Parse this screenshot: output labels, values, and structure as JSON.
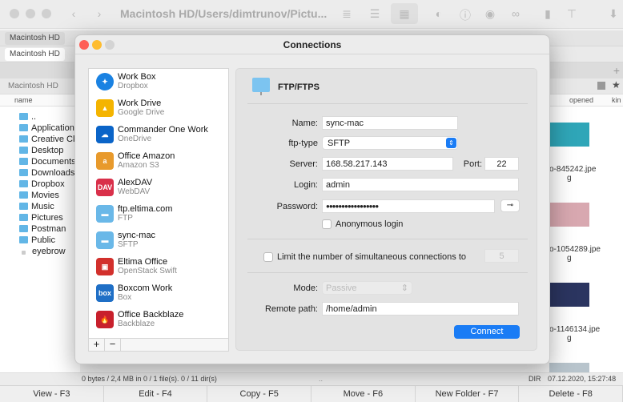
{
  "window": {
    "path_title": "Macintosh HD/Users/dimtrunov/Pictu..."
  },
  "tabs": {
    "top_left": "Macintosh HD",
    "second_left": "Macintosh HD",
    "path_left": "Macintosh HD"
  },
  "columns": {
    "left_name": "name",
    "right_opened": "opened",
    "right_kind": "kin"
  },
  "left_files": [
    "..",
    "Application",
    "Creative Cl",
    "Desktop",
    "Documents",
    "Downloads",
    "Dropbox",
    "Movies",
    "Music",
    "Pictures",
    "Postman",
    "Public",
    "eyebrow"
  ],
  "right_files": [
    {
      "name": "o-845242.jpe",
      "wrap": "g",
      "color": "#2fa6b8"
    },
    {
      "name": "o-1054289.jpe",
      "wrap": "g",
      "color": "#d8a8b0"
    },
    {
      "name": "o-1146134.jpe",
      "wrap": "g",
      "color": "#2b3560"
    }
  ],
  "status": {
    "left": "0 bytes / 2,4 MB in 0 / 1 file(s). 0 / 11 dir(s)",
    "middle": "..",
    "kind": "DIR",
    "date": "07.12.2020, 15:27:48"
  },
  "fkeys": [
    "View - F3",
    "Edit - F4",
    "Copy - F5",
    "Move - F6",
    "New Folder - F7",
    "Delete - F8"
  ],
  "dialog": {
    "title": "Connections",
    "connections": [
      {
        "name": "Work Box",
        "type": "Dropbox",
        "icon": "dropbox-icon",
        "color": "#1a82e2",
        "glyph": "✦"
      },
      {
        "name": "Work Drive",
        "type": "Google Drive",
        "icon": "google-drive-icon",
        "color": "#f4b400",
        "glyph": "▲"
      },
      {
        "name": "Commander One Work",
        "type": "OneDrive",
        "icon": "onedrive-icon",
        "color": "#0a64c8",
        "glyph": "☁"
      },
      {
        "name": "Office Amazon",
        "type": "Amazon S3",
        "icon": "amazon-s3-icon",
        "color": "#e89a2c",
        "glyph": "a"
      },
      {
        "name": "AlexDAV",
        "type": "WebDAV",
        "icon": "webdav-icon",
        "color": "#d9304a",
        "glyph": "DAV"
      },
      {
        "name": "ftp.eltima.com",
        "type": "FTP",
        "icon": "ftp-icon",
        "color": "#6ab8e8",
        "glyph": "▬"
      },
      {
        "name": "sync-mac",
        "type": "SFTP",
        "icon": "sftp-icon",
        "color": "#6ab8e8",
        "glyph": "▬"
      },
      {
        "name": "Eltima Office",
        "type": "OpenStack Swift",
        "icon": "openstack-icon",
        "color": "#d2302c",
        "glyph": "▣"
      },
      {
        "name": "Boxcom Work",
        "type": "Box",
        "icon": "box-icon",
        "color": "#1f6fc6",
        "glyph": "box"
      },
      {
        "name": "Office Backblaze",
        "type": "Backblaze",
        "icon": "backblaze-icon",
        "color": "#c8202c",
        "glyph": "🔥"
      }
    ],
    "add_label": "+",
    "remove_label": "−",
    "protocol": "FTP/FTPS",
    "form": {
      "name_label": "Name:",
      "name_value": "sync-mac",
      "ftptype_label": "ftp-type",
      "ftptype_value": "SFTP",
      "server_label": "Server:",
      "server_value": "168.58.217.143",
      "port_label": "Port:",
      "port_value": "22",
      "login_label": "Login:",
      "login_value": "admin",
      "password_label": "Password:",
      "password_value": "●●●●●●●●●●●●●●●●●",
      "anonymous_label": "Anonymous login",
      "anonymous_checked": false,
      "limit_label": "Limit the number of simultaneous connections to",
      "limit_value": "5",
      "limit_checked": false,
      "mode_label": "Mode:",
      "mode_value": "Passive",
      "remote_label": "Remote path:",
      "remote_value": "/home/admin",
      "connect_label": "Connect"
    },
    "accent": "#1a7cf5"
  }
}
